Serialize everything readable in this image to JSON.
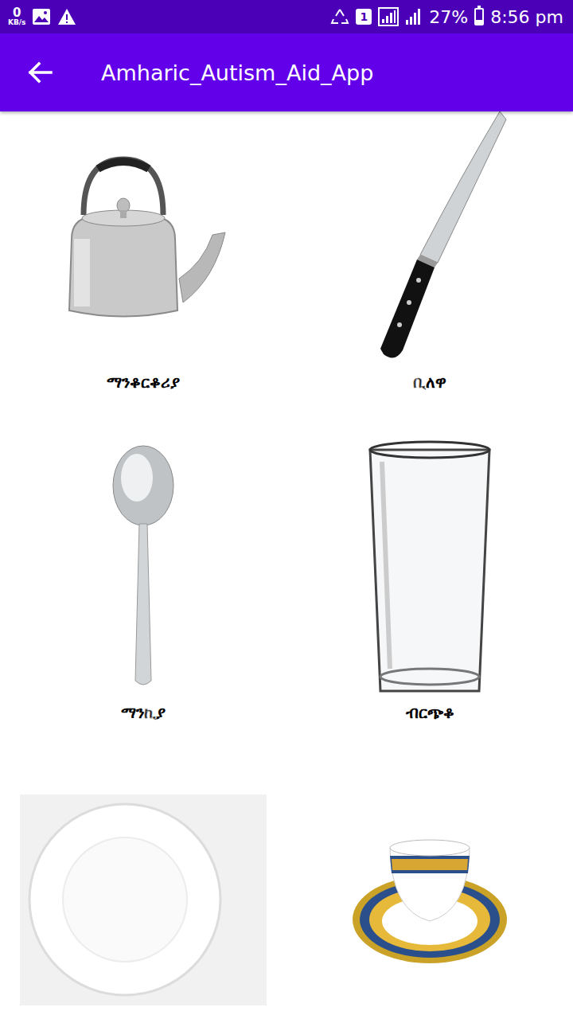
{
  "status_bar": {
    "net_speed": "0",
    "net_unit": "KB/s",
    "sim": "1",
    "battery": "27%",
    "battery_level": 0.27,
    "time": "8:56 pm"
  },
  "app_bar": {
    "title": "Amharic_Autism_Aid_App"
  },
  "items": [
    {
      "kind": "kettle",
      "label": "ማንቆርቆሪያ"
    },
    {
      "kind": "knife",
      "label": "ቢለዋ"
    },
    {
      "kind": "spoon",
      "label": "ማንኪያ"
    },
    {
      "kind": "glass",
      "label": "ብርጭቆ"
    },
    {
      "kind": "plate"
    },
    {
      "kind": "cup"
    }
  ]
}
